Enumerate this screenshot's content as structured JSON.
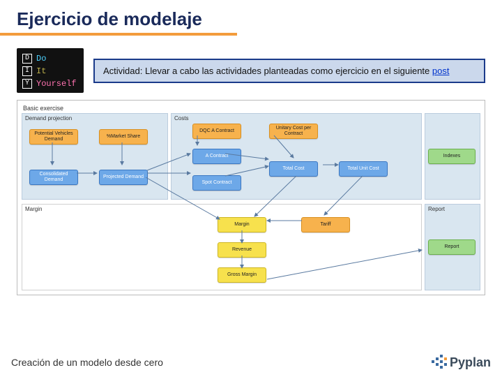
{
  "title": "Ejercicio de modelaje",
  "diy": {
    "d": "Do",
    "i": "It",
    "y": "Yourself"
  },
  "activity": {
    "text_prefix": "Actividad: Llevar a cabo las actividades planteadas como ejercicio en el siguiente ",
    "link_text": "post"
  },
  "diagram": {
    "section": "Basic exercise",
    "panels": {
      "demand": "Demand projection",
      "costs": "Costs",
      "indexes": "Indexes",
      "margin": "Margin",
      "report": "Report"
    },
    "nodes": {
      "pot_demand": "Potential Vehicles Demand",
      "market_share": "%Market Share",
      "cons_demand": "Consolidated Demand",
      "proj_demand": "Projected Demand",
      "dqc": "DQC A Contract",
      "a_contract": "A Contract",
      "spot": "Spot Contract",
      "unit_cost_contract": "Unitary Cost per Contract",
      "total_cost": "Total Cost",
      "total_unit_cost": "Total Unit Cost",
      "indexes": "Indexes",
      "margin": "Margin",
      "tariff": "Tariff",
      "revenue": "Revenue",
      "gross": "Gross Margin",
      "report": "Report"
    }
  },
  "footer": "Creación de un modelo desde cero",
  "brand": "Pyplan"
}
